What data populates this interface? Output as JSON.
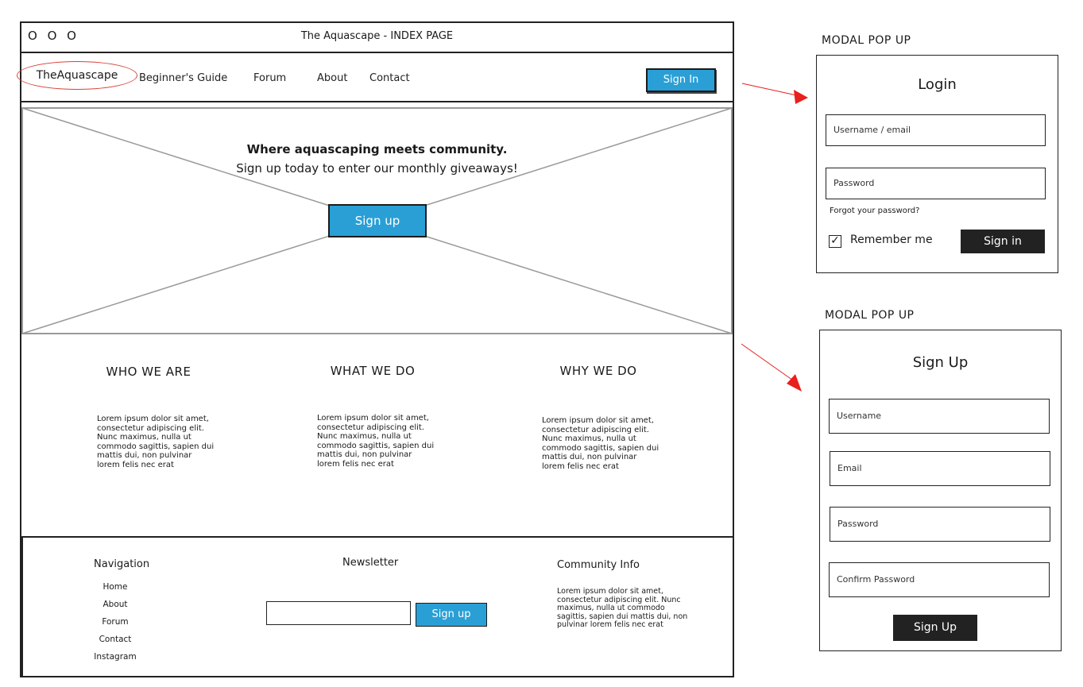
{
  "window": {
    "controls": "O O O",
    "title": "The Aquascape - INDEX PAGE"
  },
  "navbar": {
    "logo": "TheAquascape",
    "links": [
      "Beginner's Guide",
      "Forum",
      "About",
      "Contact"
    ],
    "signin_label": "Sign In"
  },
  "hero": {
    "headline": "Where aquascaping meets community.",
    "subheadline": "Sign up today to enter our monthly giveaways!",
    "cta_label": "Sign up"
  },
  "columns": [
    {
      "title": "WHO WE ARE",
      "text": "Lorem ipsum dolor sit amet, consectetur adipiscing elit. Nunc maximus, nulla ut commodo sagittis, sapien dui mattis dui, non pulvinar lorem felis nec erat"
    },
    {
      "title": "WHAT WE DO",
      "text": "Lorem ipsum dolor sit amet, consectetur adipiscing elit. Nunc maximus, nulla ut commodo sagittis, sapien dui mattis dui, non pulvinar lorem felis nec erat"
    },
    {
      "title": "WHY WE DO",
      "text": "Lorem ipsum dolor sit amet, consectetur adipiscing elit. Nunc maximus, nulla ut commodo sagittis, sapien dui mattis dui, non pulvinar lorem felis nec erat"
    }
  ],
  "footer": {
    "navigation": {
      "title": "Navigation",
      "links": [
        "Home",
        "About",
        "Forum",
        "Contact",
        "Instagram"
      ]
    },
    "newsletter": {
      "title": "Newsletter",
      "input_value": "",
      "button_label": "Sign up"
    },
    "community": {
      "title": "Community Info",
      "text": "Lorem ipsum dolor sit amet, consectetur adipiscing elit. Nunc maximus, nulla ut commodo sagittis, sapien dui mattis dui, non pulvinar lorem felis nec erat"
    }
  },
  "login_modal": {
    "label": "MODAL POP UP",
    "title": "Login",
    "username_placeholder": "Username / email",
    "password_placeholder": "Password",
    "forgot_link": "Forgot your password?",
    "remember_label": "Remember me",
    "remember_checked": true,
    "submit_label": "Sign in"
  },
  "signup_modal": {
    "label": "MODAL POP UP",
    "title": "Sign Up",
    "fields": [
      "Username",
      "Email",
      "Password",
      "Confirm Password"
    ],
    "submit_label": "Sign Up"
  },
  "colors": {
    "accent_blue": "#2a9fd6",
    "arrow_red": "#e8201e",
    "dark_button": "#222222"
  }
}
